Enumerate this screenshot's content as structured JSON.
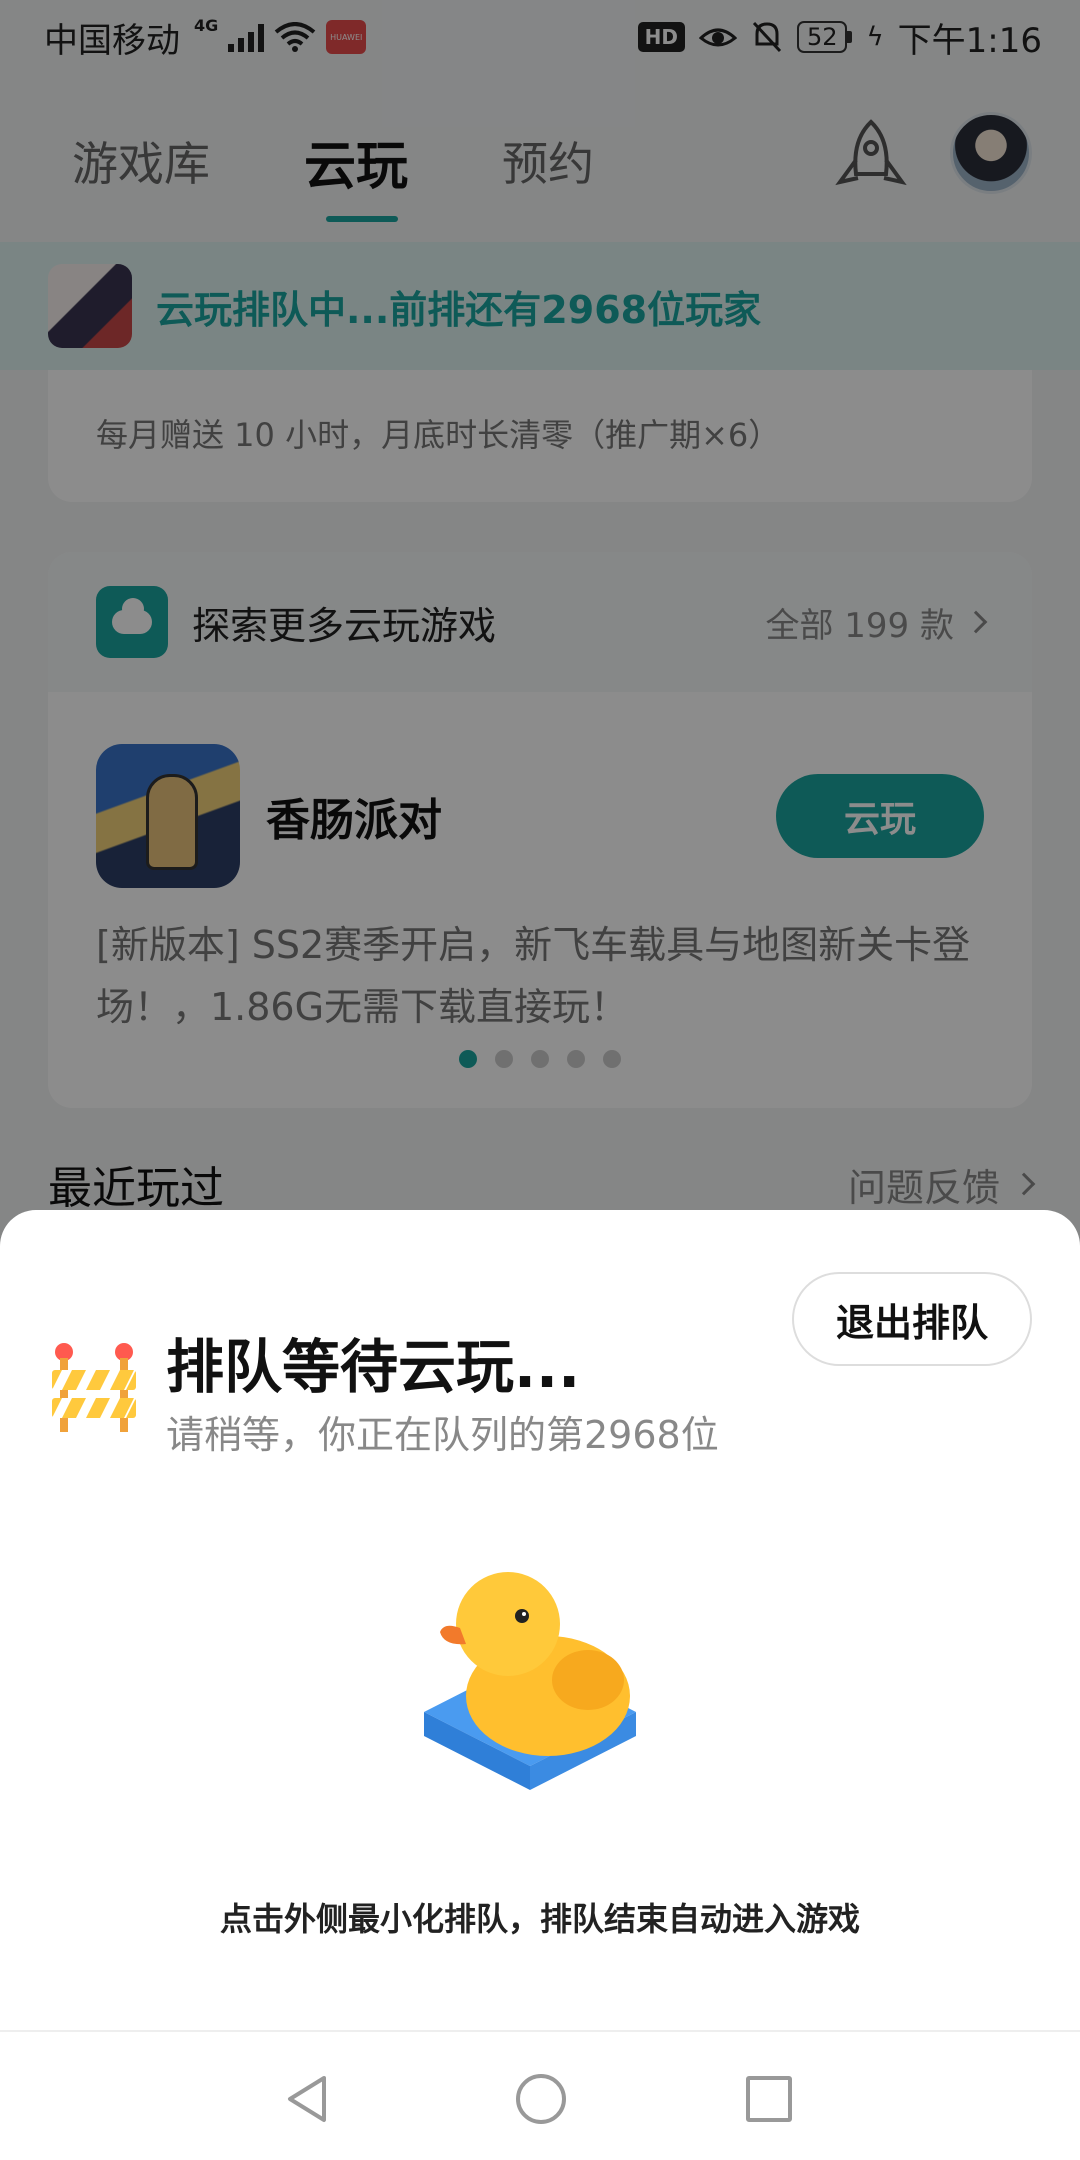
{
  "status_bar": {
    "carrier": "中国移动",
    "network": "4G",
    "app_badge": "HUAWEI",
    "hd": "HD",
    "battery": "52",
    "time": "下午1:16"
  },
  "nav": {
    "tabs": [
      {
        "label": "游戏库"
      },
      {
        "label": "云玩"
      },
      {
        "label": "预约"
      }
    ],
    "active_tab": "云玩"
  },
  "queue_banner": {
    "text": "云玩排队中...前排还有2968位玩家"
  },
  "promo_card": {
    "text": "每月赠送 10 小时，月底时长清零（推广期×6）"
  },
  "explore_card": {
    "title": "探索更多云玩游戏",
    "all_label": "全部 199 款",
    "game": {
      "name": "香肠派对",
      "play_label": "云玩",
      "description": "[新版本] SS2赛季开启，新飞车载具与地图新关卡登场！，1.86G无需下载直接玩！"
    },
    "carousel": {
      "count": 5,
      "active_index": 0
    }
  },
  "recent": {
    "title": "最近玩过",
    "feedback_label": "问题反馈"
  },
  "sheet": {
    "exit_label": "退出排队",
    "title": "排队等待云玩...",
    "subtitle": "请稍等，你正在队列的第2968位",
    "hint": "点击外侧最小化排队，排队结束自动进入游戏"
  },
  "colors": {
    "accent": "#1aa59f",
    "banner_bg": "#dff3f1",
    "overlay": "rgba(0,0,0,0.45)"
  }
}
